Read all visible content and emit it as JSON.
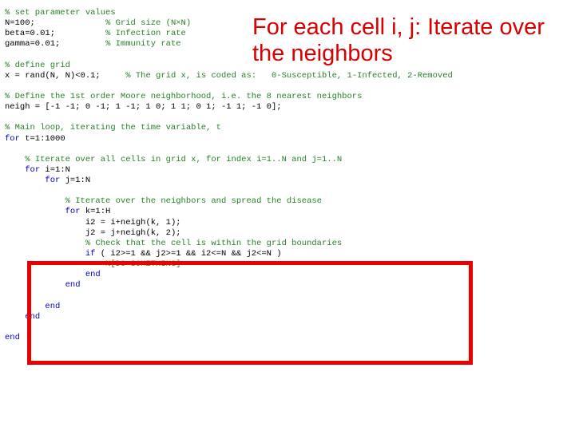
{
  "title": "For each cell i, j: Iterate over the neighbors",
  "code": {
    "c1": "% set parameter values",
    "l1a": "N=100;",
    "c1a": "% Grid size (N×N)",
    "l1b": "beta=0.01;",
    "c1b": "% Infection rate",
    "l1c": "gamma=0.01;",
    "c1c": "% Immunity rate",
    "c2": "% define grid",
    "l2a": "x = rand(N, N)<0.1;",
    "c2a": "% The grid x, is coded as:   0-Susceptible, 1-Infected, 2-Removed",
    "c3": "% Define the 1st order Moore neighborhood, i.e. the 8 nearest neighbors",
    "l3a": "neigh = [-1 -1; 0 -1; 1 -1; 1 0; 1 1; 0 1; -1 1; -1 0];",
    "c4": "% Main loop, iterating the time variable, t",
    "kw_for": "for",
    "l4a": " t=1:1000",
    "c5": "% Iterate over all cells in grid x, for index i=1..N and j=1..N",
    "l5a": " i=1:N",
    "l5b": " j=1:N",
    "c6": "% Iterate over the neighbors and spread the disease",
    "l6a": " k=1:H",
    "l6b": "i2 = i+neigh(k, 1);",
    "l6c": "j2 = j+neigh(k, 2);",
    "c7": "% Check that the cell is within the grid boundaries",
    "kw_if": "if",
    "l7a": " ( i2>=1 && j2>=1 && i2<=N && j2<=N )",
    "c8": "%[DO SOMETHING]",
    "kw_end": "end"
  }
}
